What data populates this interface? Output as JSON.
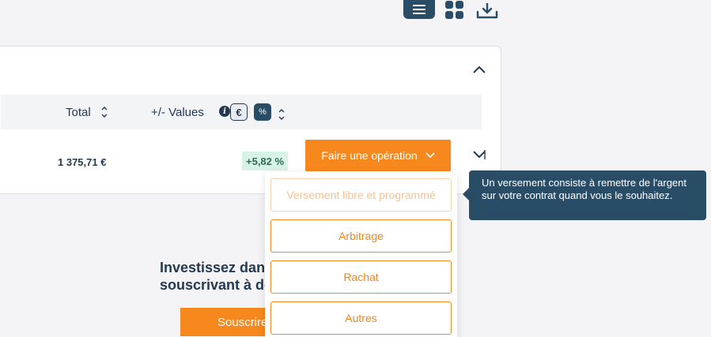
{
  "toolbar": {
    "list_view_icon": "list-icon",
    "grid_view_icon": "grid-icon",
    "download_icon": "download-icon"
  },
  "table": {
    "header": {
      "total_label": "Total",
      "values_label": "+/- Values",
      "unit_euro": "€",
      "unit_percent": "%"
    },
    "row": {
      "total": "1 375,71 €",
      "performance": "+5,82 %",
      "operation_button": "Faire une opération"
    }
  },
  "dropdown": {
    "items": [
      {
        "label": "Versement libre et programmé",
        "disabled": true
      },
      {
        "label": "Arbitrage",
        "disabled": false
      },
      {
        "label": "Rachat",
        "disabled": false
      },
      {
        "label": "Autres",
        "disabled": false
      }
    ]
  },
  "tooltip": {
    "text": "Un versement consiste à remettre de l'argent sur votre contrat quand vous le souhaitez."
  },
  "promo": {
    "line1": "Investissez dans",
    "line2": "souscrivant à de",
    "button": "Souscrire"
  },
  "colors": {
    "accent": "#f7881d",
    "navy": "#2a4d67",
    "badge_bg": "#d9f2e7"
  }
}
